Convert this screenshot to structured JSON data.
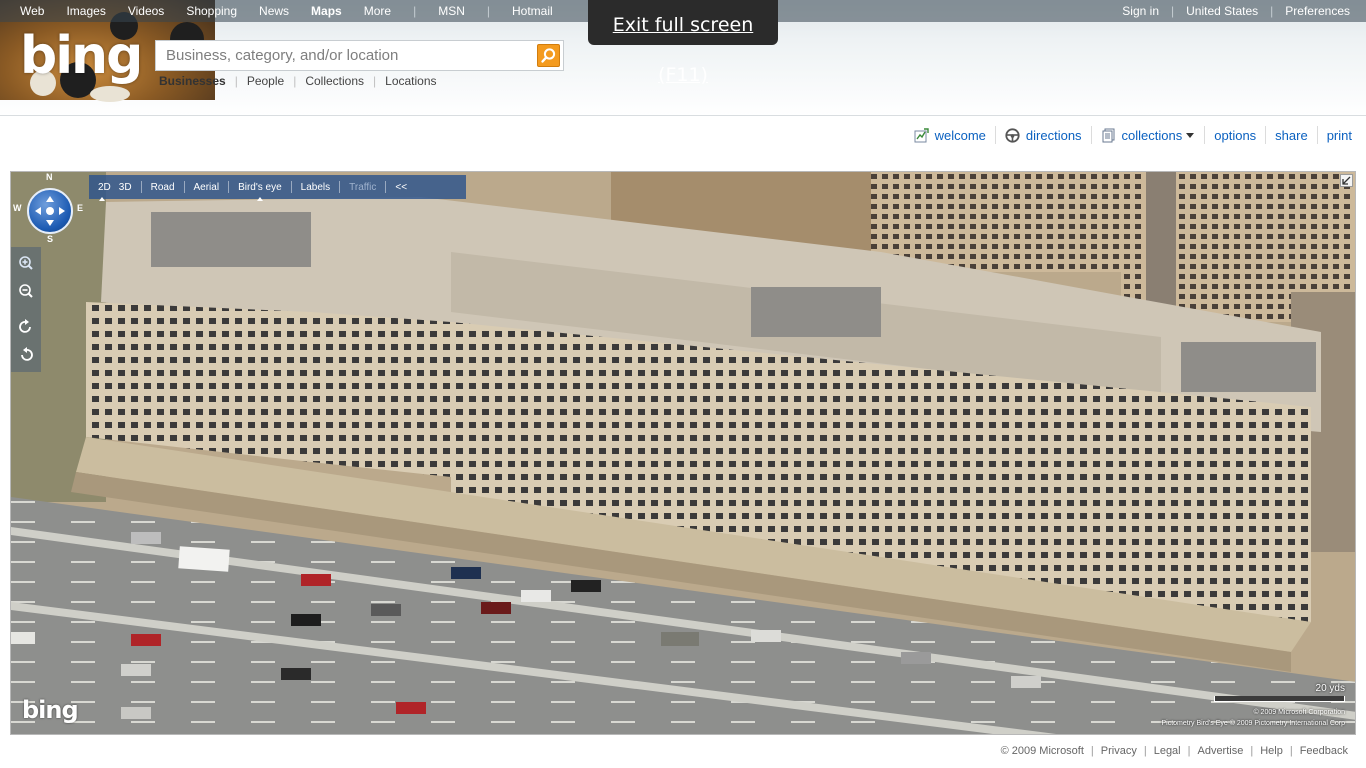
{
  "topnav": {
    "left": [
      {
        "label": "Web"
      },
      {
        "label": "Images"
      },
      {
        "label": "Videos"
      },
      {
        "label": "Shopping"
      },
      {
        "label": "News"
      },
      {
        "label": "Maps",
        "active": true
      },
      {
        "label": "More"
      }
    ],
    "right_of_sep": [
      {
        "label": "MSN"
      },
      {
        "label": "Hotmail"
      }
    ],
    "account": [
      "Sign in",
      "United States",
      "Preferences"
    ]
  },
  "logo": "bing",
  "search": {
    "placeholder": "Business, category, and/or location",
    "value": "",
    "scopes": [
      {
        "label": "Businesses",
        "active": true
      },
      {
        "label": "People"
      },
      {
        "label": "Collections"
      },
      {
        "label": "Locations"
      }
    ]
  },
  "fullscreen_tip": "Exit full screen (F11)",
  "actions": [
    {
      "label": "welcome",
      "icon": "welcome-icon"
    },
    {
      "label": "directions",
      "icon": "steering-wheel-icon"
    },
    {
      "label": "collections",
      "icon": "collections-icon",
      "dropdown": true
    },
    {
      "label": "options"
    },
    {
      "label": "share"
    },
    {
      "label": "print"
    }
  ],
  "map": {
    "view_modes": [
      "2D",
      "3D"
    ],
    "selected_view": "2D",
    "styles": [
      "Road",
      "Aerial",
      "Bird's eye"
    ],
    "selected_style": "Bird's eye",
    "labels": "Labels",
    "traffic": "Traffic",
    "collapse": "<<",
    "compass": {
      "n": "N",
      "s": "S",
      "e": "E",
      "w": "W"
    },
    "logo": "bing",
    "scale_label": "20 yds",
    "copyright": [
      "© 2009 Microsoft Corporation",
      "Pictometry Bird's Eye © 2009 Pictometry International Corp"
    ]
  },
  "footer": [
    "© 2009 Microsoft",
    "Privacy",
    "Legal",
    "Advertise",
    "Help",
    "Feedback"
  ],
  "colors": {
    "link_blue": "#0b61c0",
    "search_button": "#f49b1f",
    "toolbar": "#2c538c"
  }
}
